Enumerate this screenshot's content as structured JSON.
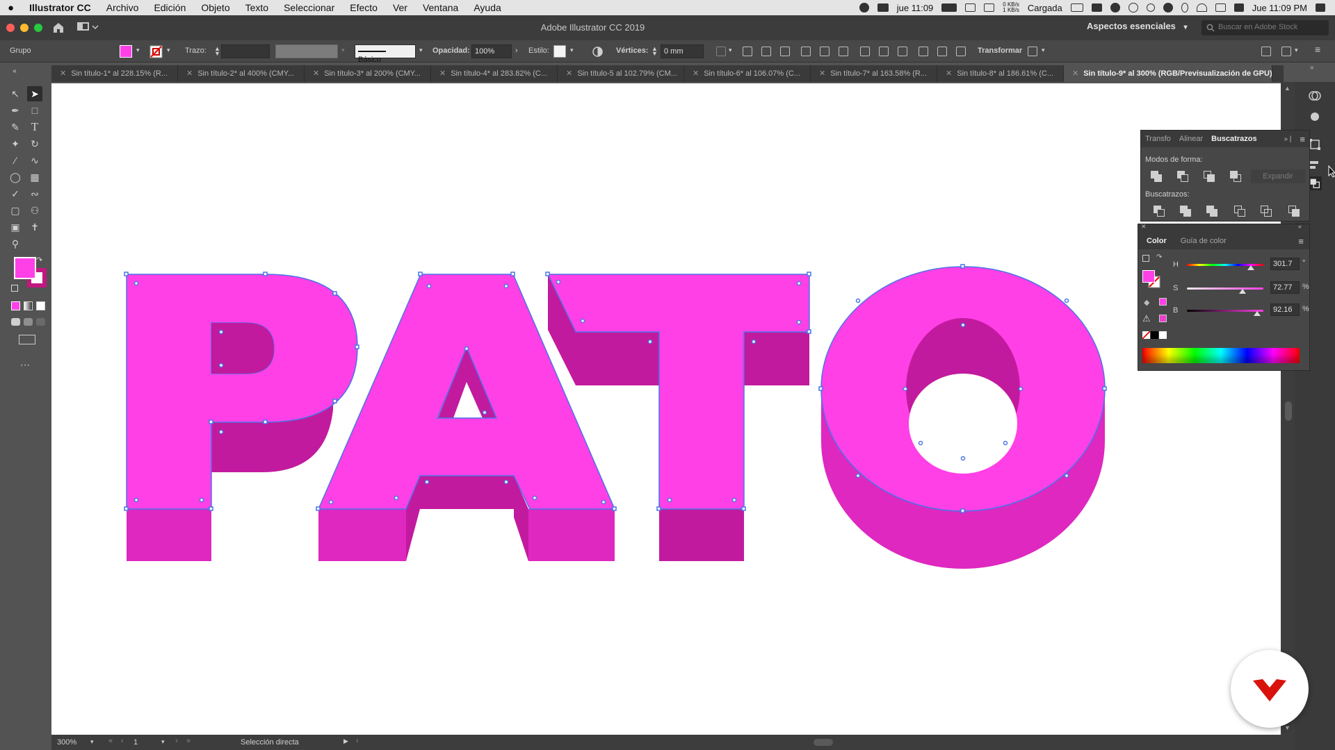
{
  "menubar": {
    "app_name": "Illustrator CC",
    "items": [
      "Archivo",
      "Edición",
      "Objeto",
      "Texto",
      "Seleccionar",
      "Efecto",
      "Ver",
      "Ventana",
      "Ayuda"
    ],
    "clock_short": "jue 11:09",
    "net_speed_up": "0 KB/s",
    "net_speed_down": "1 KB/s",
    "battery": "Cargada",
    "clock_full": "Jue 11:09 PM"
  },
  "titlebar": {
    "title": "Adobe Illustrator CC 2019",
    "workspace": "Aspectos esenciales",
    "stock_placeholder": "Buscar en Adobe Stock"
  },
  "controlbar": {
    "selection_label": "Grupo",
    "stroke_label": "Trazo:",
    "brush_label": "Básico",
    "opacity_label": "Opacidad:",
    "opacity_value": "100%",
    "style_label": "Estilo:",
    "vertices_label": "Vértices:",
    "vertices_value": "0 mm",
    "transform_label": "Transformar",
    "fill_color": "#ff40e6"
  },
  "tabs": [
    {
      "label": "Sin título-1* al 228.15% (R..."
    },
    {
      "label": "Sin título-2* al 400% (CMY..."
    },
    {
      "label": "Sin título-3* al 200% (CMY..."
    },
    {
      "label": "Sin título-4* al 283.82% (C..."
    },
    {
      "label": "Sin título-5 al 102.79% (CM..."
    },
    {
      "label": "Sin título-6* al 106.07% (C..."
    },
    {
      "label": "Sin título-7* al 163.58% (R..."
    },
    {
      "label": "Sin título-8* al 186.61% (C..."
    },
    {
      "label": "Sin título-9* al 300% (RGB/Previsualización de GPU)"
    }
  ],
  "pathfinder_panel": {
    "tabs": [
      "Transfo",
      "Alinear",
      "Buscatrazos"
    ],
    "active_tab": "Buscatrazos",
    "shape_modes_label": "Modos de forma:",
    "expand_label": "Expandir",
    "pathfinders_label": "Buscatrazos:"
  },
  "color_panel": {
    "tabs": [
      "Color",
      "Guía de color"
    ],
    "active_tab": "Color",
    "h_label": "H",
    "h_value": "301.7",
    "h_unit": "°",
    "s_label": "S",
    "s_value": "72.77",
    "s_unit": "%",
    "b_label": "B",
    "b_value": "92.16",
    "b_unit": "%",
    "h_fraction": 0.838,
    "s_fraction": 0.728,
    "b_fraction": 0.922
  },
  "statusbar": {
    "zoom": "300%",
    "artboard": "1",
    "tool_status": "Selección directa"
  },
  "artwork": {
    "letters": [
      "P",
      "A",
      "T",
      "O"
    ],
    "face_color": "#ff40e6",
    "side_color": "#de28c0",
    "inner_color": "#c21a9e"
  }
}
